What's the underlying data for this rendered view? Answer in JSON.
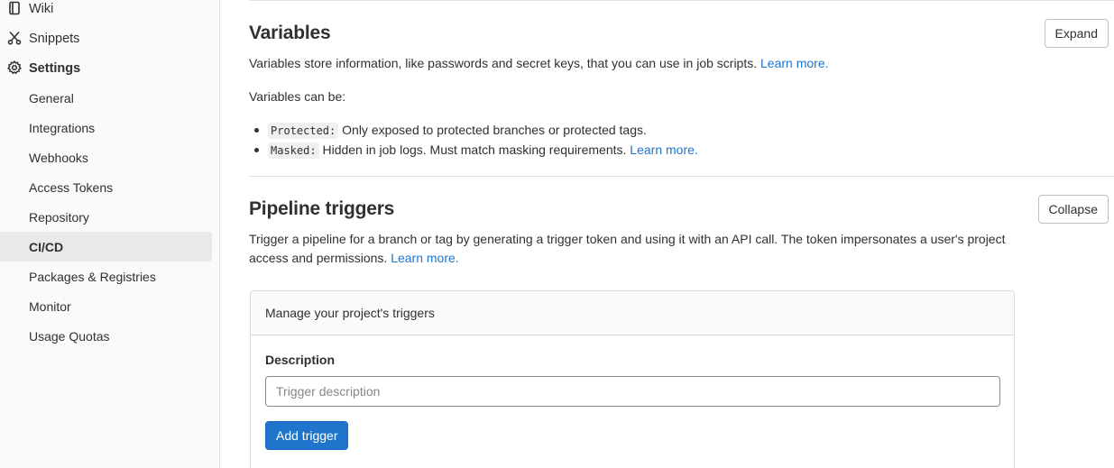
{
  "sidebar": {
    "items": [
      {
        "label": "Wiki",
        "icon": "book-icon"
      },
      {
        "label": "Snippets",
        "icon": "scissors-icon"
      },
      {
        "label": "Settings",
        "icon": "gear-icon"
      },
      {
        "label": "General"
      },
      {
        "label": "Integrations"
      },
      {
        "label": "Webhooks"
      },
      {
        "label": "Access Tokens"
      },
      {
        "label": "Repository"
      },
      {
        "label": "CI/CD"
      },
      {
        "label": "Packages & Registries"
      },
      {
        "label": "Monitor"
      },
      {
        "label": "Usage Quotas"
      }
    ]
  },
  "variables": {
    "title": "Variables",
    "button": "Expand",
    "description": "Variables store information, like passwords and secret keys, that you can use in job scripts.",
    "learn_more": "Learn more.",
    "can_be": "Variables can be:",
    "bullets": [
      {
        "code": "Protected:",
        "text": "Only exposed to protected branches or protected tags."
      },
      {
        "code": "Masked:",
        "text": "Hidden in job logs. Must match masking requirements.",
        "link": "Learn more."
      }
    ]
  },
  "triggers": {
    "title": "Pipeline triggers",
    "button": "Collapse",
    "description": "Trigger a pipeline for a branch or tag by generating a trigger token and using it with an API call. The token impersonates a user's project access and permissions.",
    "learn_more": "Learn more.",
    "card_header": "Manage your project's triggers",
    "field_label": "Description",
    "placeholder": "Trigger description",
    "submit": "Add trigger"
  },
  "colors": {
    "link": "#1f75cb",
    "primary_button": "#1f75cb",
    "active_nav_bg": "#e9e9ec"
  }
}
